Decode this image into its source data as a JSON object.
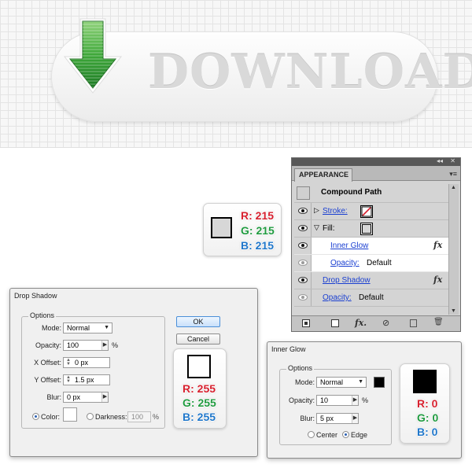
{
  "banner": {
    "button_text": "DOWNLOAD",
    "icon": "download-arrow-icon"
  },
  "chip_gray": {
    "r": "R: 215",
    "g": "G: 215",
    "b": "B: 215",
    "swatch_color": "#d7d7d7"
  },
  "chip_white": {
    "r": "R: 255",
    "g": "G: 255",
    "b": "B: 255",
    "swatch_color": "#ffffff"
  },
  "chip_black": {
    "r": "R: 0",
    "g": "G: 0",
    "b": "B: 0",
    "swatch_color": "#000000"
  },
  "appearance": {
    "tab": "APPEARANCE",
    "title": "Compound Path",
    "rows": {
      "stroke": "Stroke:",
      "fill": "Fill:",
      "inner_glow": "Inner Glow",
      "inner_opacity_label": "Opacity:",
      "inner_opacity_value": "Default",
      "drop_shadow": "Drop Shadow",
      "opacity_label": "Opacity:",
      "opacity_value": "Default"
    },
    "fx_label": "fx",
    "toolbar_fx": "fx."
  },
  "drop_shadow": {
    "title": "Drop Shadow",
    "options_label": "Options",
    "mode_label": "Mode:",
    "mode_value": "Normal",
    "opacity_label": "Opacity:",
    "opacity_value": "100",
    "percent": "%",
    "x_offset_label": "X Offset:",
    "x_offset_value": "0 px",
    "y_offset_label": "Y Offset:",
    "y_offset_value": "1.5 px",
    "blur_label": "Blur:",
    "blur_value": "0 px",
    "color_label": "Color:",
    "darkness_label": "Darkness:",
    "darkness_value": "100",
    "ok": "OK",
    "cancel": "Cancel"
  },
  "inner_glow": {
    "title": "Inner Glow",
    "options_label": "Options",
    "mode_label": "Mode:",
    "mode_value": "Normal",
    "opacity_label": "Opacity:",
    "opacity_value": "10",
    "percent": "%",
    "blur_label": "Blur:",
    "blur_value": "5 px",
    "center_label": "Center",
    "edge_label": "Edge",
    "glow_color": "#000000"
  },
  "colors": {
    "red": "#d6202e",
    "green": "#1f9a3f",
    "blue": "#1f76c9",
    "arrow_green": "#3aa33a"
  }
}
